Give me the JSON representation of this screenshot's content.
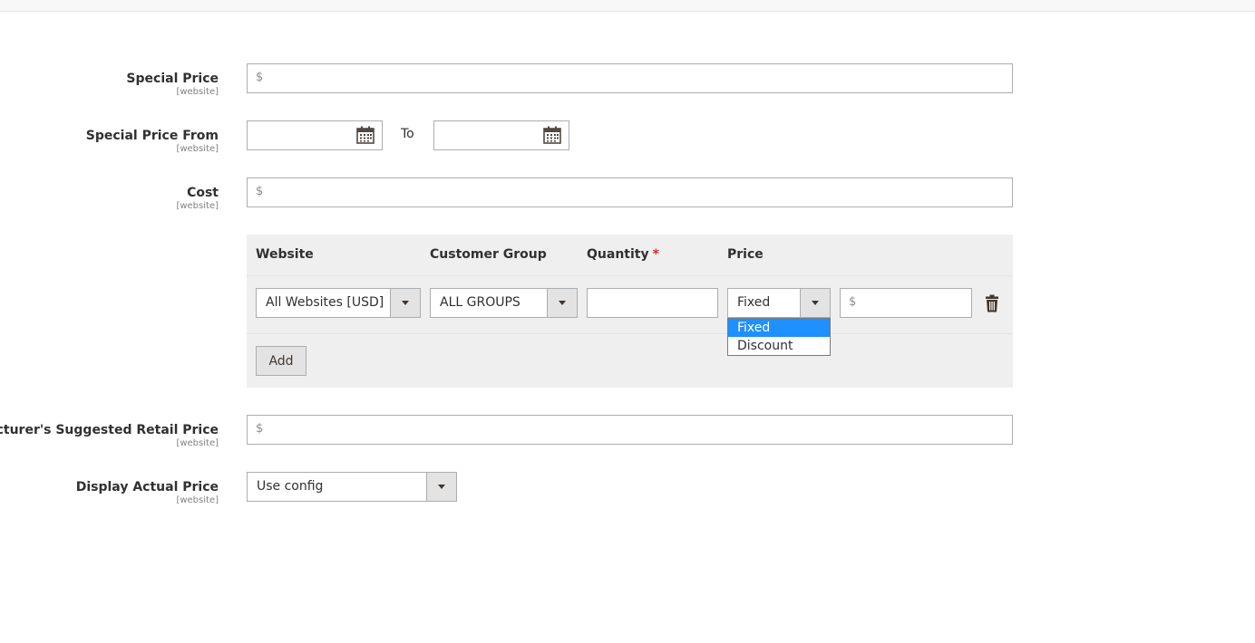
{
  "special_price": {
    "label": "Special Price",
    "scope": "[website]",
    "prefix": "$",
    "value": ""
  },
  "special_price_from": {
    "label": "Special Price From",
    "scope": "[website]",
    "to_label": "To",
    "from_value": "",
    "to_value": ""
  },
  "cost": {
    "label": "Cost",
    "scope": "[website]",
    "prefix": "$",
    "value": ""
  },
  "tier_price": {
    "headers": {
      "website": "Website",
      "customer_group": "Customer Group",
      "quantity": "Quantity",
      "required_mark": "*",
      "price": "Price"
    },
    "row": {
      "website": "All Websites [USD]",
      "customer_group": "ALL GROUPS",
      "quantity": "",
      "price_type": "Fixed",
      "price_prefix": "$",
      "price_value": ""
    },
    "price_type_options": [
      "Fixed",
      "Discount"
    ],
    "add_label": "Add"
  },
  "msrp": {
    "label": "anufacturer's Suggested Retail Price",
    "scope": "[website]",
    "prefix": "$",
    "value": ""
  },
  "display_actual_price": {
    "label": "Display Actual Price",
    "scope": "[website]",
    "value": "Use config"
  },
  "colors": {
    "highlight": "#1e90ff",
    "required": "#e22626",
    "panel": "#efefef"
  },
  "icons": {
    "calendar": "calendar-icon",
    "delete": "trash-icon",
    "dropdown": "chevron-down-icon"
  }
}
